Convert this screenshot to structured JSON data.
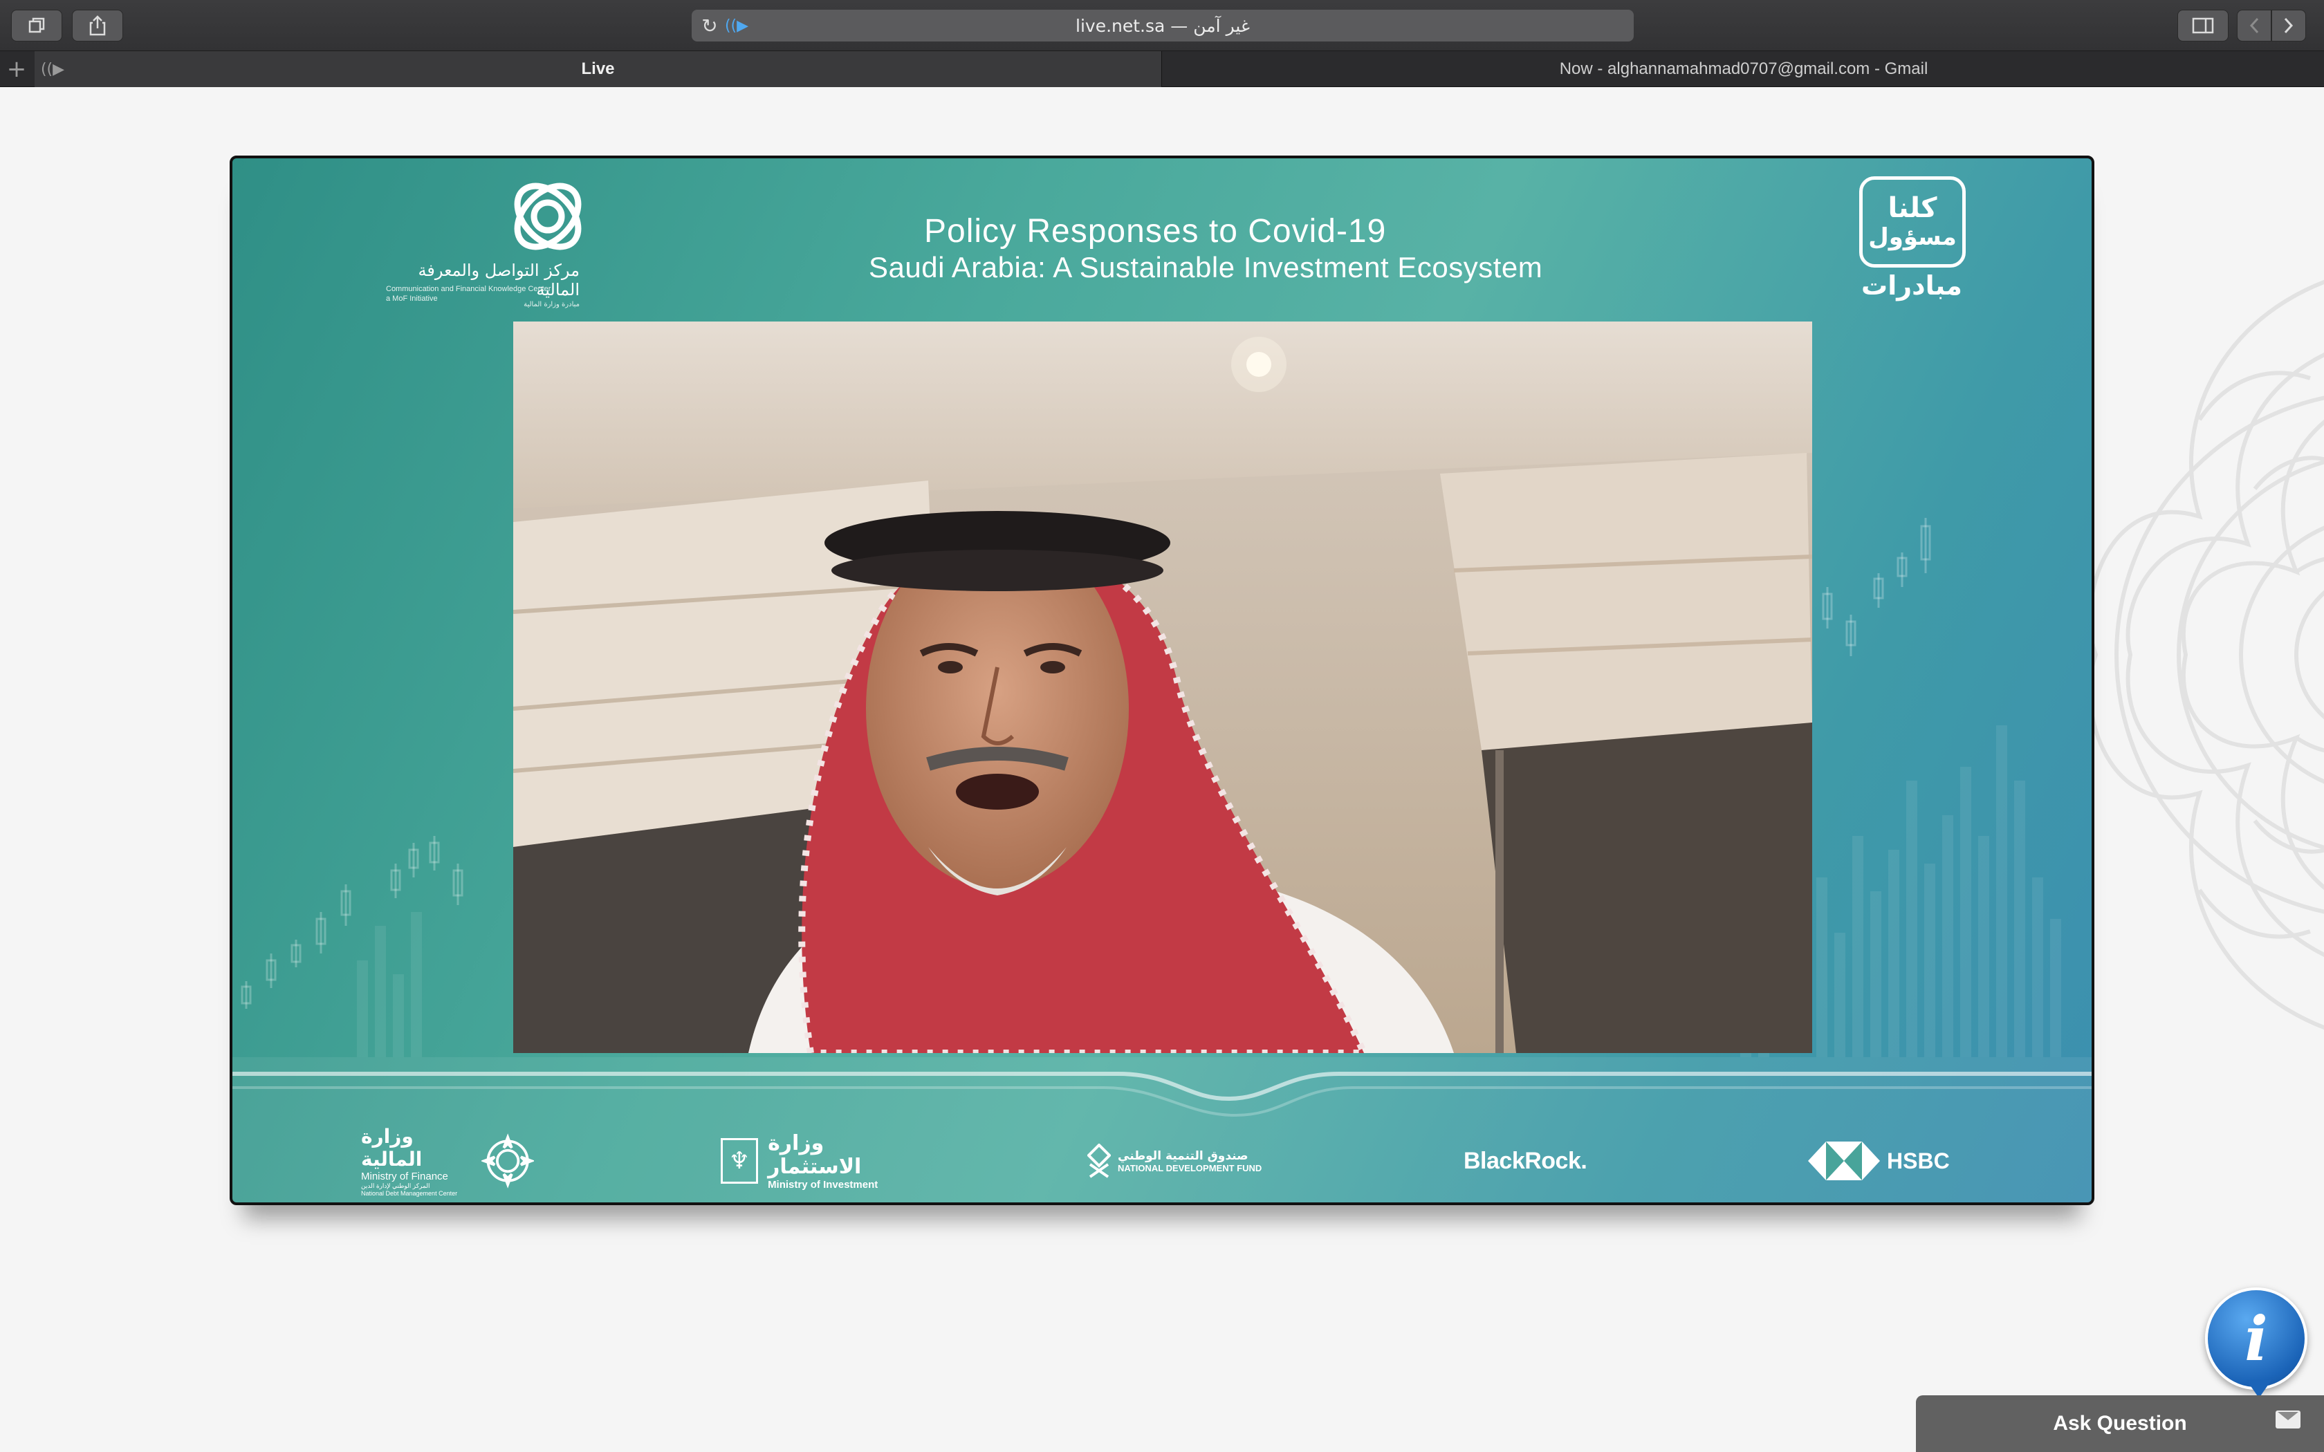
{
  "browser": {
    "address_text": "live.net.sa — غير آمن",
    "reload_glyph": "↻",
    "audio_glyph": "((▶",
    "new_tab_glyph": "+",
    "tabs": [
      {
        "label": "Live",
        "audio_glyph": "((▶"
      },
      {
        "label": "Now - alghannamahmad0707@gmail.com - Gmail"
      }
    ],
    "buttons": {
      "tab_overview_icon": "tabs-icon",
      "share_icon": "share-icon",
      "sidebar_icon": "sidebar-icon",
      "back_icon": "chevron-left-icon",
      "forward_icon": "chevron-right-icon"
    }
  },
  "stream": {
    "title": "Policy Responses to Covid-19",
    "subtitle": "Saudi Arabia: A Sustainable Investment Ecosystem",
    "logo_left": {
      "arabic": "مركز التواصل والمعرفة المالية",
      "english": "Communication and Financial Knowledge Center",
      "english2": "a MoF Initiative",
      "arabic2": "مبادرة وزارة المالية"
    },
    "logo_right": {
      "line1": "كلنا",
      "line2": "مسؤول",
      "line3": "مبادرات"
    },
    "sponsors": {
      "mof_ar": "وزارة المالية",
      "mof_en": "Ministry of Finance",
      "mof_small_ar": "المركز الوطني لإدارة الدين",
      "mof_small_en": "National Debt Management Center",
      "moi_ar": "وزارة الاستثمار",
      "moi_en": "Ministry of Investment",
      "ndf_ar": "صندوق التنمية الوطني",
      "ndf_en": "NATIONAL DEVELOPMENT FUND",
      "blackrock": "BlackRock.",
      "hsbc": "HSBC"
    },
    "colors": {
      "teal": "#4aa99c",
      "blue": "#3c8fb0"
    }
  },
  "widgets": {
    "info_glyph": "i",
    "ask_question": "Ask Question"
  }
}
